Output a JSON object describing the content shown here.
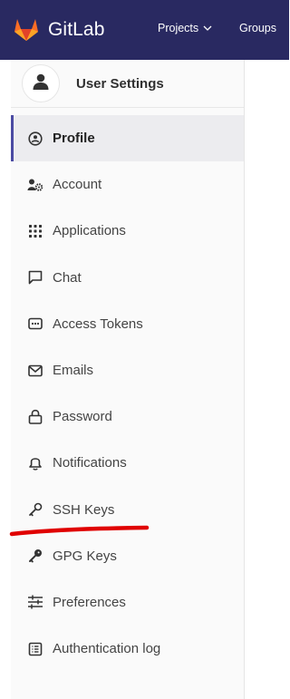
{
  "topbar": {
    "brand": "GitLab",
    "projects_label": "Projects",
    "groups_label": "Groups",
    "brand_color": "#292961"
  },
  "sidebar": {
    "context_title": "User Settings",
    "active_indicator_color": "#4b4ba3",
    "items": [
      {
        "label": "Profile",
        "icon": "profile-icon",
        "active": true
      },
      {
        "label": "Account",
        "icon": "account-icon",
        "active": false
      },
      {
        "label": "Applications",
        "icon": "applications-icon",
        "active": false
      },
      {
        "label": "Chat",
        "icon": "chat-icon",
        "active": false
      },
      {
        "label": "Access Tokens",
        "icon": "token-icon",
        "active": false
      },
      {
        "label": "Emails",
        "icon": "mail-icon",
        "active": false
      },
      {
        "label": "Password",
        "icon": "lock-icon",
        "active": false
      },
      {
        "label": "Notifications",
        "icon": "bell-icon",
        "active": false
      },
      {
        "label": "SSH Keys",
        "icon": "key-icon",
        "active": false
      },
      {
        "label": "GPG Keys",
        "icon": "key-icon",
        "active": false
      },
      {
        "label": "Preferences",
        "icon": "sliders-icon",
        "active": false
      },
      {
        "label": "Authentication log",
        "icon": "log-icon",
        "active": false
      }
    ]
  },
  "annotation": {
    "target": "SSH Keys",
    "color": "#e00000",
    "shape": "underline stroke"
  }
}
